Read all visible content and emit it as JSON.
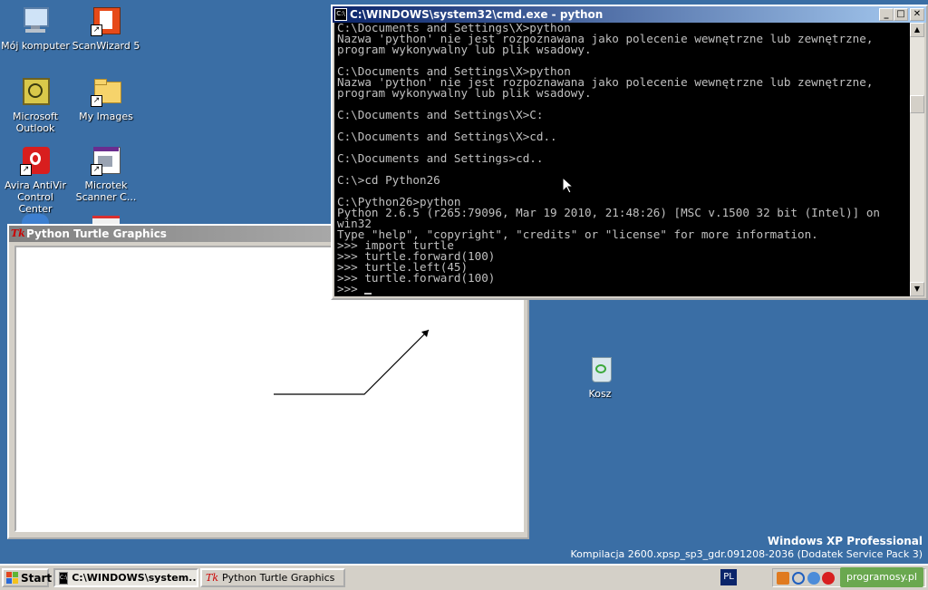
{
  "desktop": {
    "icons": [
      {
        "label": "Mój komputer",
        "icon": "my-computer-icon"
      },
      {
        "label": "ScanWizard 5",
        "icon": "scanwizard-icon"
      },
      {
        "label": "Microsoft Outlook",
        "icon": "outlook-icon"
      },
      {
        "label": "My Images",
        "icon": "folder-icon"
      },
      {
        "label": "Avira AntiVir Control Center",
        "icon": "avira-icon"
      },
      {
        "label": "Microtek Scanner C...",
        "icon": "microtek-icon"
      },
      {
        "label": "Kosz",
        "icon": "recycle-bin-icon"
      }
    ],
    "os_name": "Windows XP Professional",
    "os_build": "Kompilacja 2600.xpsp_sp3_gdr.091208-2036 (Dodatek Service Pack 3)"
  },
  "cmd_window": {
    "title": "C:\\WINDOWS\\system32\\cmd.exe - python",
    "lines": [
      "C:\\Documents and Settings\\X>python",
      "Nazwa 'python' nie jest rozpoznawana jako polecenie wewnętrzne lub zewnętrzne,",
      "program wykonywalny lub plik wsadowy.",
      "",
      "C:\\Documents and Settings\\X>python",
      "Nazwa 'python' nie jest rozpoznawana jako polecenie wewnętrzne lub zewnętrzne,",
      "program wykonywalny lub plik wsadowy.",
      "",
      "C:\\Documents and Settings\\X>C:",
      "",
      "C:\\Documents and Settings\\X>cd..",
      "",
      "C:\\Documents and Settings>cd..",
      "",
      "C:\\>cd Python26",
      "",
      "C:\\Python26>python",
      "Python 2.6.5 (r265:79096, Mar 19 2010, 21:48:26) [MSC v.1500 32 bit (Intel)] on",
      "win32",
      "Type \"help\", \"copyright\", \"credits\" or \"license\" for more information.",
      ">>> import turtle",
      ">>> turtle.forward(100)",
      ">>> turtle.left(45)",
      ">>> turtle.forward(100)",
      ">>> "
    ]
  },
  "turtle_window": {
    "title": "Python Turtle Graphics"
  },
  "taskbar": {
    "start_label": "Start",
    "tasks": [
      {
        "label": "C:\\WINDOWS\\system...",
        "active": true
      },
      {
        "label": "Python Turtle Graphics",
        "active": false
      }
    ],
    "language": "PL",
    "watermark": "programosy.pl"
  }
}
